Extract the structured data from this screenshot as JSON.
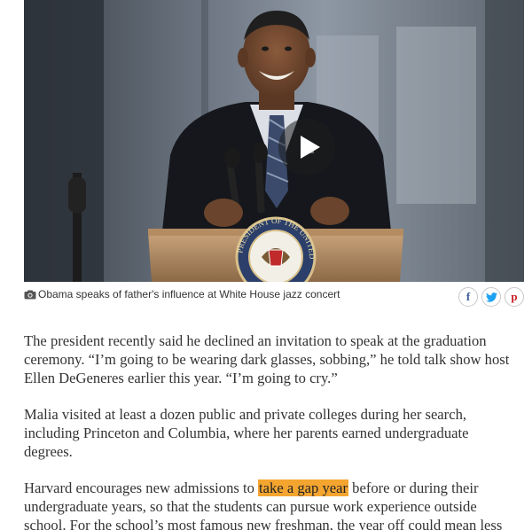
{
  "video": {
    "play_icon": "play-icon",
    "seal_text": "PRESIDENT OF THE UNITED STATES",
    "seal_text_visible": "PRESIDENT OF THE UNITED ST"
  },
  "caption": {
    "icon": "camera-icon",
    "text": "Obama speaks of father's influence at White House jazz concert"
  },
  "share": {
    "facebook_glyph": "f",
    "twitter_glyph": "t",
    "pinterest_glyph": "p",
    "facebook_icon": "facebook-icon",
    "twitter_icon": "twitter-icon",
    "pinterest_icon": "pinterest-icon"
  },
  "article": {
    "p1": "The president recently said he declined an invitation to speak at the graduation ceremony. “I’m going to be wearing dark glasses, sobbing,” he told talk show host Ellen DeGeneres earlier this year. “I’m going to cry.”",
    "p2": "Malia visited at least a dozen public and private colleges during her search, including Princeton and Columbia, where her parents earned undergraduate degrees.",
    "p3_before": "Harvard encourages new admissions to ",
    "p3_highlight": "take a gap year",
    "p3_after": " before or during their undergraduate years, so that the students can pursue work experience outside school. For the school’s most famous new freshman, the year off could mean less"
  },
  "colors": {
    "highlight": "#f4a530",
    "text": "#333333",
    "facebook": "#3b5998",
    "twitter": "#1da1f2",
    "pinterest": "#cb2027"
  }
}
